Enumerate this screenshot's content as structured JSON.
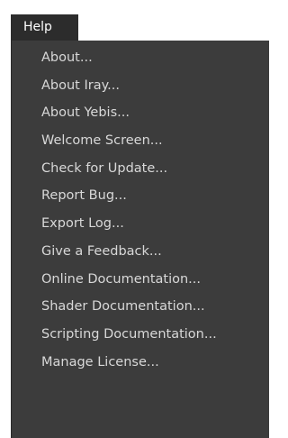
{
  "menubar": {
    "active_menu": "Help"
  },
  "help_menu": {
    "items": [
      {
        "label": "About..."
      },
      {
        "label": "About Iray..."
      },
      {
        "label": "About Yebis..."
      },
      {
        "label": "Welcome Screen..."
      },
      {
        "label": "Check for Update..."
      },
      {
        "label": "Report Bug..."
      },
      {
        "label": "Export Log..."
      },
      {
        "label": "Give a Feedback..."
      },
      {
        "label": "Online Documentation..."
      },
      {
        "label": "Shader Documentation..."
      },
      {
        "label": "Scripting Documentation..."
      },
      {
        "label": "Manage License..."
      }
    ]
  },
  "colors": {
    "menu_background": "#3c3c3c",
    "tab_background": "#2c2c2c",
    "item_text": "#d8d8d8",
    "tab_text": "#ffffff"
  }
}
